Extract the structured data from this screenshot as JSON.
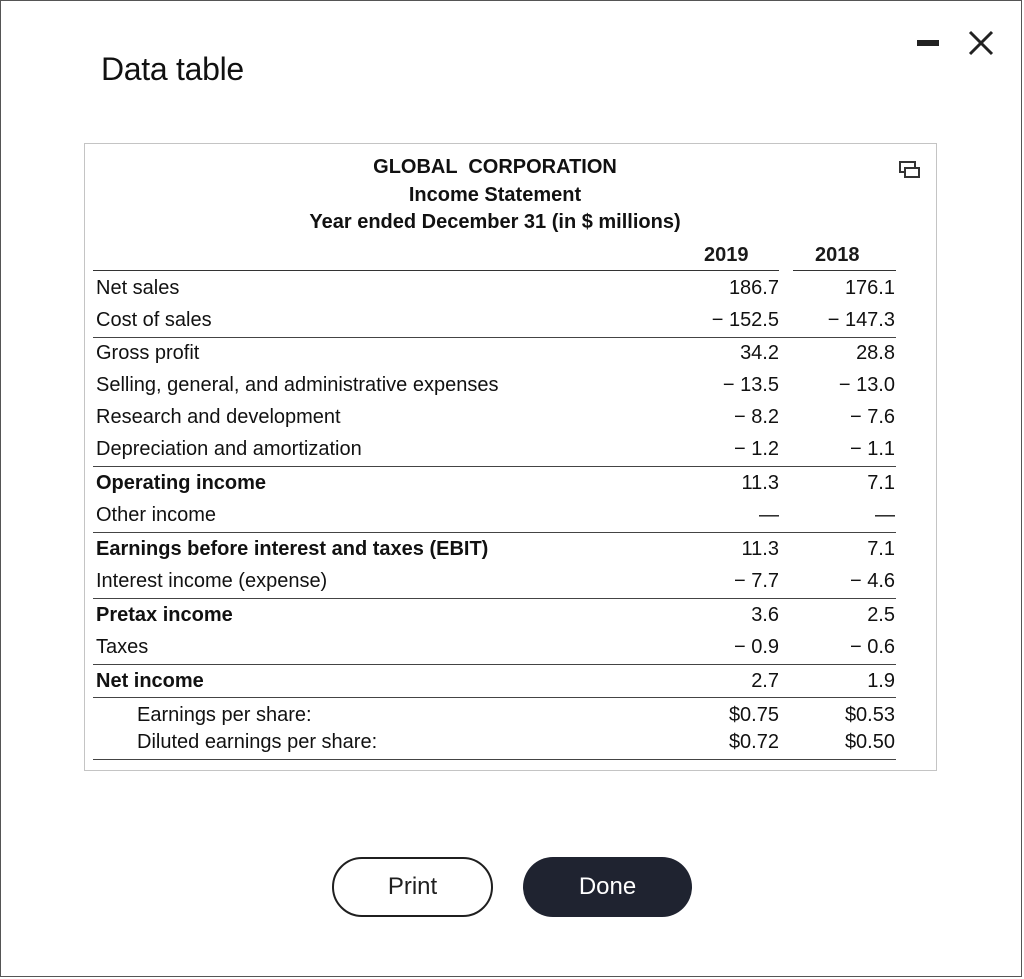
{
  "dialog": {
    "title": "Data table",
    "print_label": "Print",
    "done_label": "Done",
    "icons": [
      "minimize-icon",
      "close-icon",
      "popout-icon"
    ]
  },
  "statement": {
    "company": "GLOBAL  CORPORATION",
    "name": "Income Statement",
    "period": "Year ended December 31 (in $ millions)",
    "col_2019": "2019",
    "col_2018": "2018",
    "rows": [
      {
        "label": "Net sales",
        "y2019": "186.7",
        "y2018": "176.1"
      },
      {
        "label": "Cost of sales",
        "y2019": "− 152.5",
        "y2018": "− 147.3"
      },
      {
        "label": "Gross profit",
        "y2019": "34.2",
        "y2018": "28.8"
      },
      {
        "label": "Selling, general, and administrative expenses",
        "y2019": "− 13.5",
        "y2018": "− 13.0"
      },
      {
        "label": "Research and development",
        "y2019": "− 8.2",
        "y2018": "− 7.6"
      },
      {
        "label": "Depreciation and amortization",
        "y2019": "− 1.2",
        "y2018": "− 1.1"
      },
      {
        "label": "Operating income",
        "y2019": "11.3",
        "y2018": "7.1"
      },
      {
        "label": "Other income",
        "y2019": "—",
        "y2018": "—"
      },
      {
        "label": "Earnings before interest and taxes (EBIT)",
        "y2019": "11.3",
        "y2018": "7.1"
      },
      {
        "label": "Interest income (expense)",
        "y2019": "− 7.7",
        "y2018": "− 4.6"
      },
      {
        "label": "Pretax income",
        "y2019": "3.6",
        "y2018": "2.5"
      },
      {
        "label": "Taxes",
        "y2019": "− 0.9",
        "y2018": "− 0.6"
      },
      {
        "label": "Net income",
        "y2019": "2.7",
        "y2018": "1.9"
      },
      {
        "label": "Earnings per share:",
        "y2019": "$0.75",
        "y2018": "$0.53"
      },
      {
        "label": "Diluted earnings per share:",
        "y2019": "$0.72",
        "y2018": "$0.50"
      }
    ]
  }
}
